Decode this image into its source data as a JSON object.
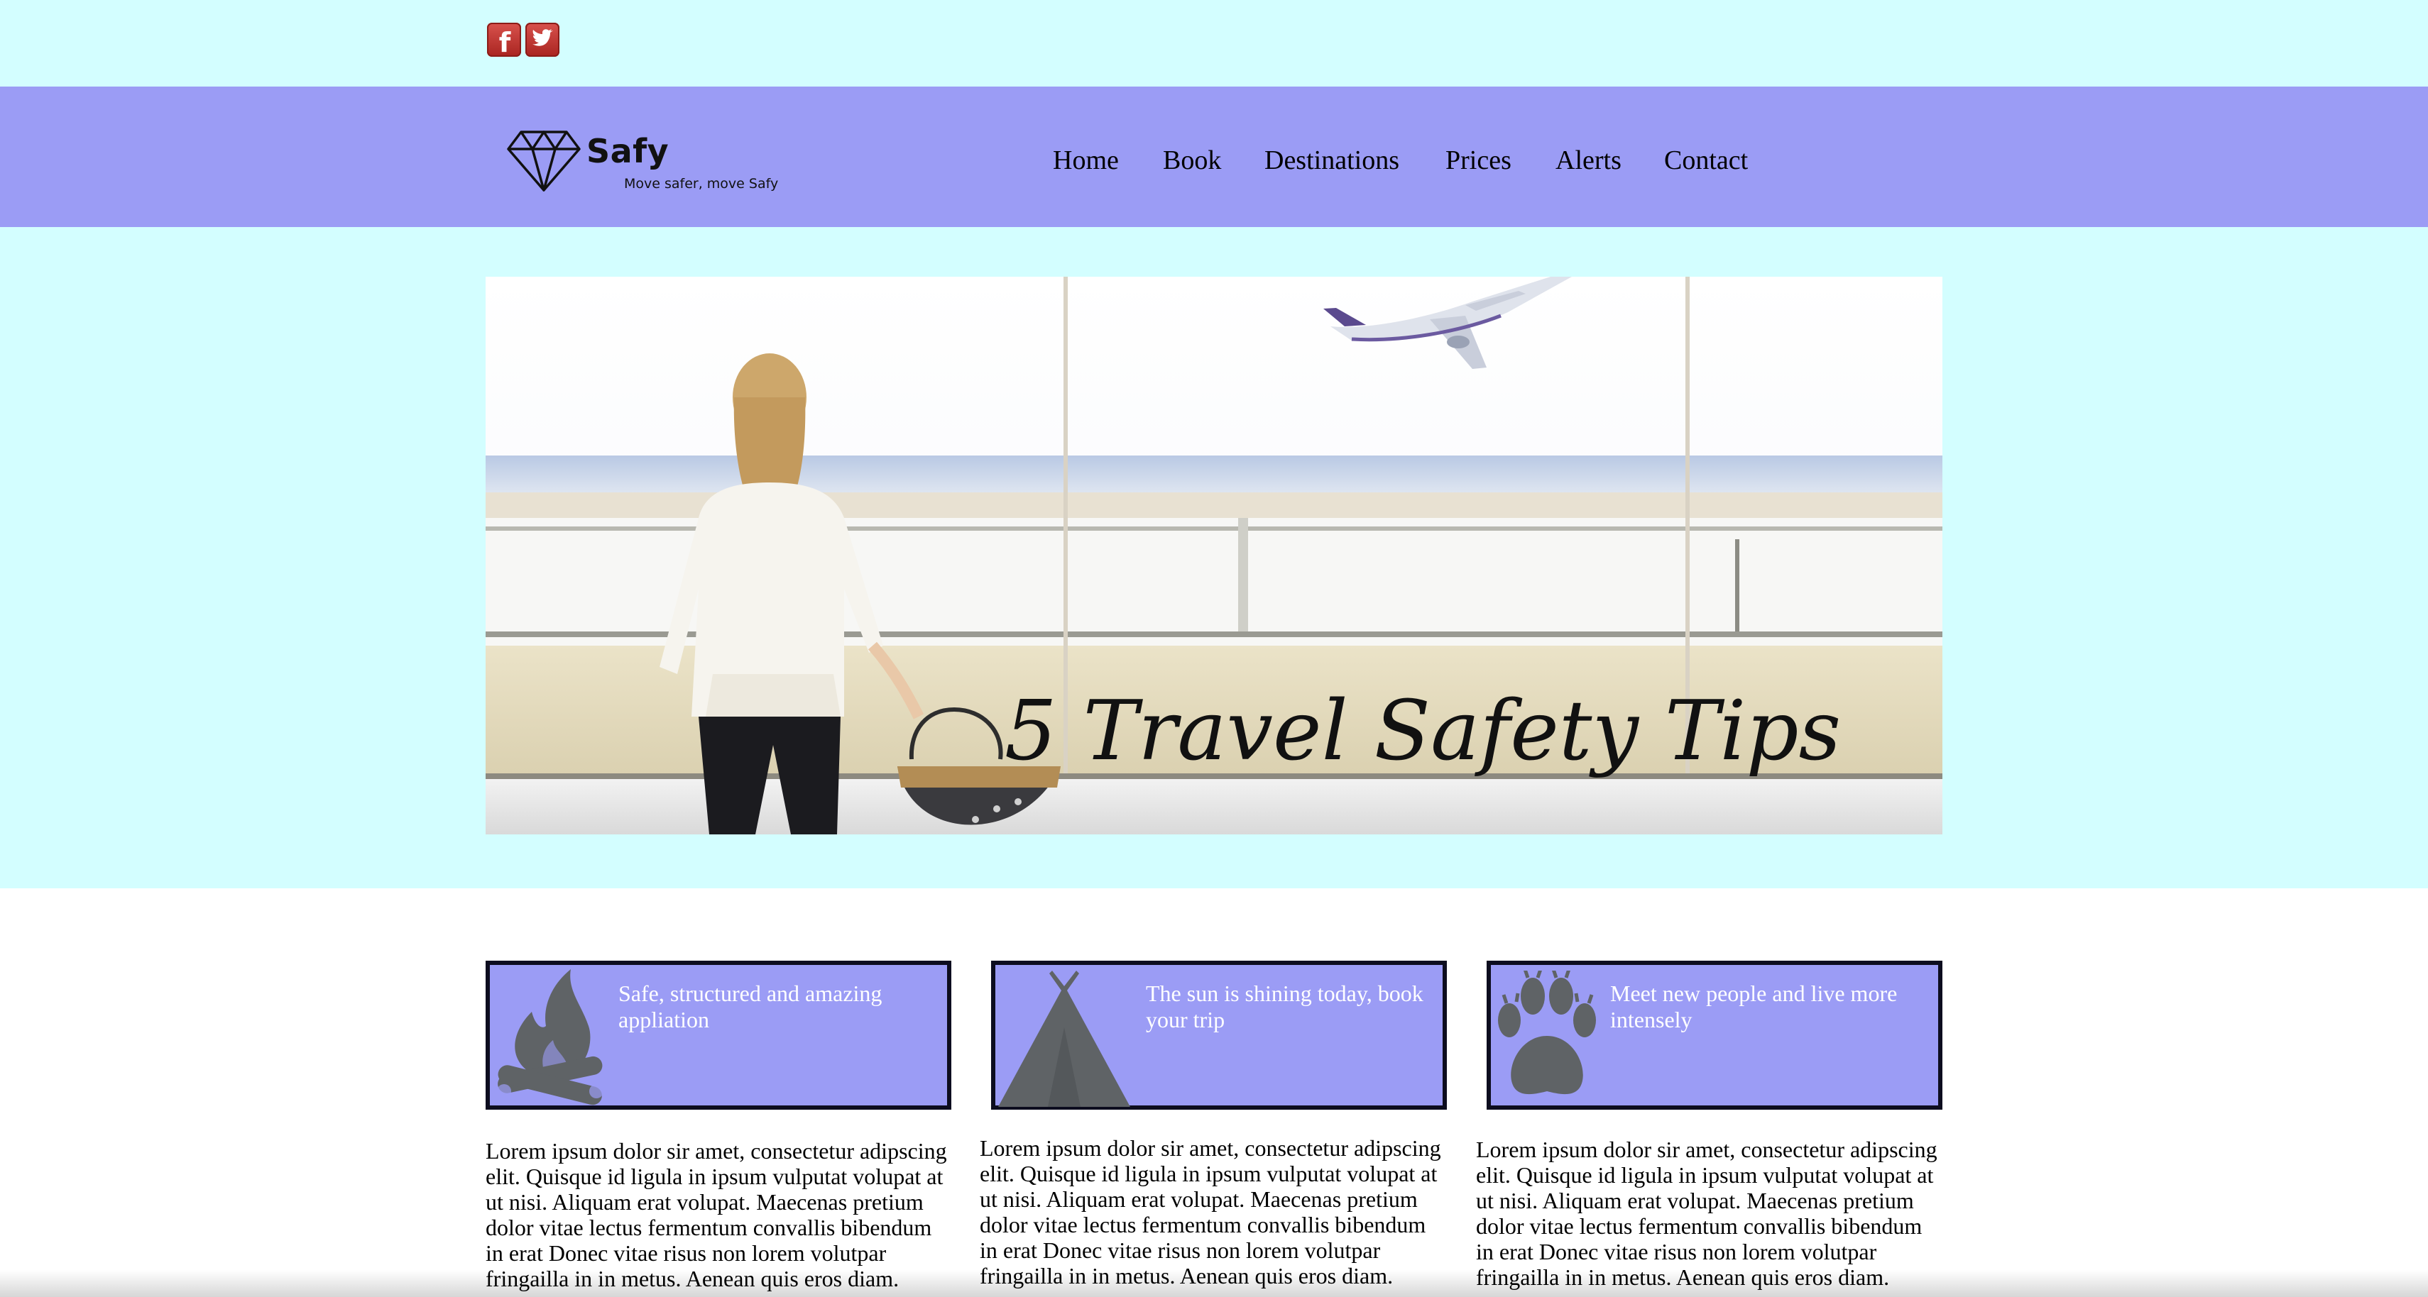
{
  "header": {
    "social": [
      {
        "name": "facebook",
        "icon": "facebook-icon",
        "glyph": "f"
      },
      {
        "name": "twitter",
        "icon": "twitter-bird-icon"
      }
    ]
  },
  "brand": {
    "name": "Safy",
    "tagline": "Move safer, move Safy",
    "icon": "diamond-icon"
  },
  "nav": {
    "items": [
      "Home",
      "Book",
      "Destinations",
      "Prices",
      "Alerts",
      "Contact"
    ]
  },
  "hero": {
    "caption": "5 Travel Safety Tips",
    "image": "woman-watching-airplane-photo"
  },
  "features": [
    {
      "title": "Safe, structured and amazing appliation",
      "icon": "campfire-icon",
      "body": "Lorem ipsum dolor sir amet, consectetur adipscing elit. Quisque id ligula in ipsum vulputat volupat at ut nisi. Aliquam erat volupat. Maecenas pretium dolor vitae lectus fermentum convallis bibendum in erat Donec vitae risus non lorem volutpar fringailla in in metus. Aenean quis eros diam."
    },
    {
      "title": "The sun is shining today, book your trip",
      "icon": "tent-icon",
      "body": "Lorem ipsum dolor sir amet, consectetur adipscing elit. Quisque id ligula in ipsum vulputat volupat at ut nisi. Aliquam erat volupat. Maecenas pretium dolor vitae lectus fermentum convallis bibendum in erat Donec vitae risus non lorem volutpar fringailla in in metus. Aenean quis eros diam."
    },
    {
      "title": "Meet new people and live more intensely",
      "icon": "paw-print-icon",
      "body": "Lorem ipsum dolor sir amet, consectetur adipscing elit. Quisque id ligula in ipsum vulputat volupat at ut nisi. Aliquam erat volupat. Maecenas pretium dolor vitae lectus fermentum convallis bibendum in erat Donec vitae risus non lorem volutpar fringailla in in metus. Aenean quis eros diam."
    }
  ],
  "colors": {
    "background": "#d3feff",
    "nav_background": "#9b9cf5",
    "card_background": "#9b9cf5",
    "card_border": "#0d0d1f",
    "icon_gray": "#5f6366",
    "social_red": "#c0322d"
  }
}
